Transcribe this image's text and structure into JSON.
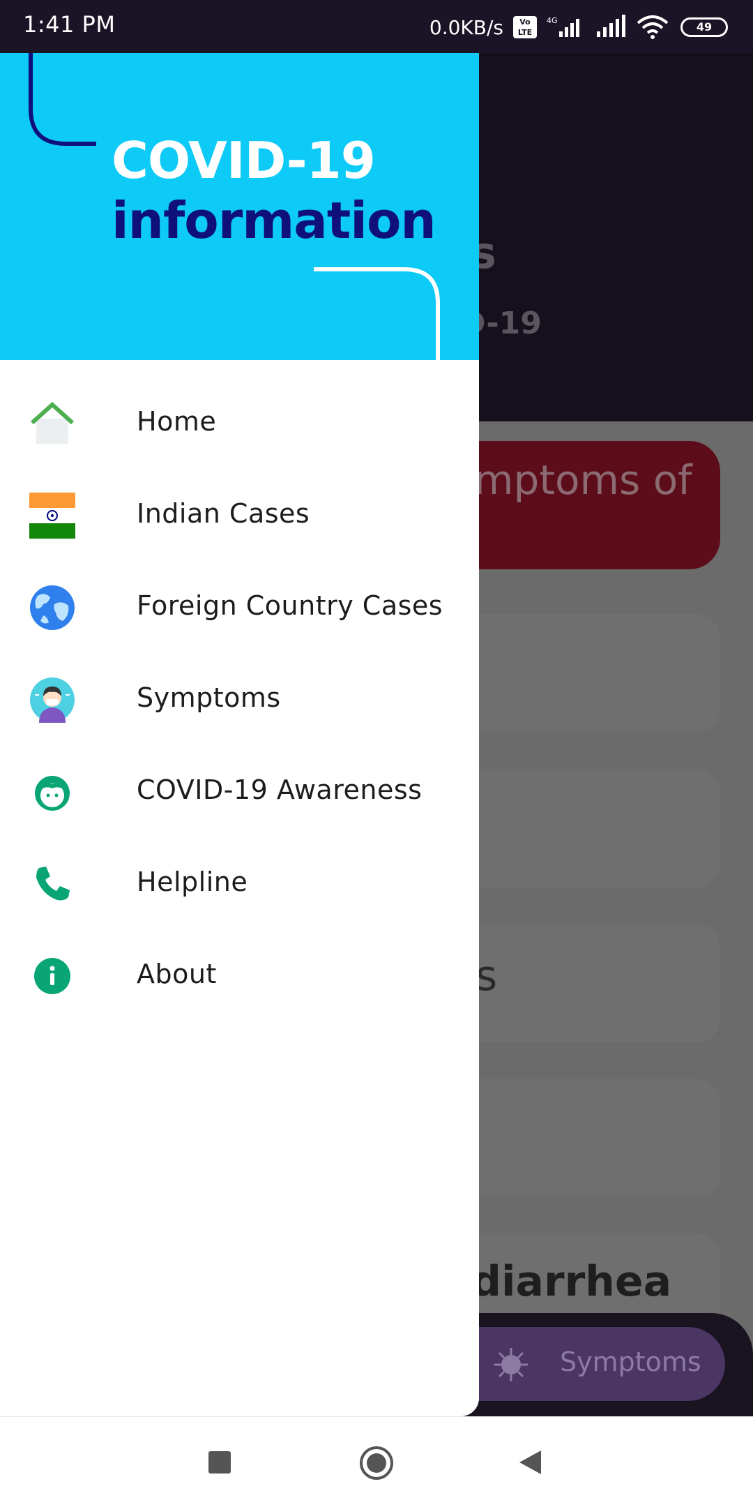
{
  "status_bar": {
    "time": "1:41 PM",
    "network_speed": "0.0KB/s",
    "volte_top": "Vo",
    "volte_bottom": "LTE",
    "network_type": "4G",
    "battery_level": "49"
  },
  "drawer": {
    "title_line1": "COVID-19",
    "title_line2": "information",
    "header_color": "#0dcaf7",
    "title_accent_color": "#10107a",
    "items": [
      {
        "label": "Home",
        "icon": "home-icon"
      },
      {
        "label": "Indian Cases",
        "icon": "india-flag-icon"
      },
      {
        "label": "Foreign Country Cases",
        "icon": "globe-icon"
      },
      {
        "label": "Symptoms",
        "icon": "sick-person-icon"
      },
      {
        "label": "COVID-19 Awareness",
        "icon": "face-icon"
      },
      {
        "label": "Helpline",
        "icon": "phone-icon"
      },
      {
        "label": "About",
        "icon": "info-icon"
      }
    ]
  },
  "background_app": {
    "header_fragment_1": "s",
    "header_fragment_2": "D-19",
    "banner_fragment": "mptoms of",
    "list_fragment": "s",
    "list_fragment_2": "diarrhea",
    "bottom_nav_active_label": "Symptoms",
    "bottom_nav_active_icon": "virus-icon"
  },
  "nav_bar": {
    "buttons": [
      "recents-button",
      "home-button",
      "back-button"
    ]
  }
}
